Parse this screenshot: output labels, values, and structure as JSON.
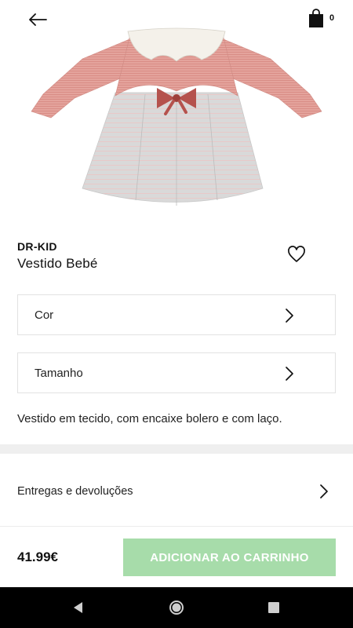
{
  "header": {
    "back_icon": "arrow-left-icon",
    "cart_icon": "shopping-bag-icon",
    "cart_count": "0"
  },
  "product": {
    "image_icon": "baby-dress-photo",
    "brand": "DR-KID",
    "name": "Vestido Bebé",
    "wishlist_icon": "heart-outline-icon",
    "description": "Vestido em tecido, com encaixe bolero e com laço."
  },
  "options": {
    "color_label": "Cor",
    "size_label": "Tamanho"
  },
  "info": {
    "delivery_label": "Entregas e devoluções"
  },
  "footer": {
    "price": "41.99€",
    "add_to_cart_label": "ADICIONAR AO CARRINHO",
    "button_color": "#a7dcaa"
  },
  "android_nav": {
    "back_icon": "triangle-back-icon",
    "home_icon": "circle-home-icon",
    "recents_icon": "square-recents-icon"
  }
}
